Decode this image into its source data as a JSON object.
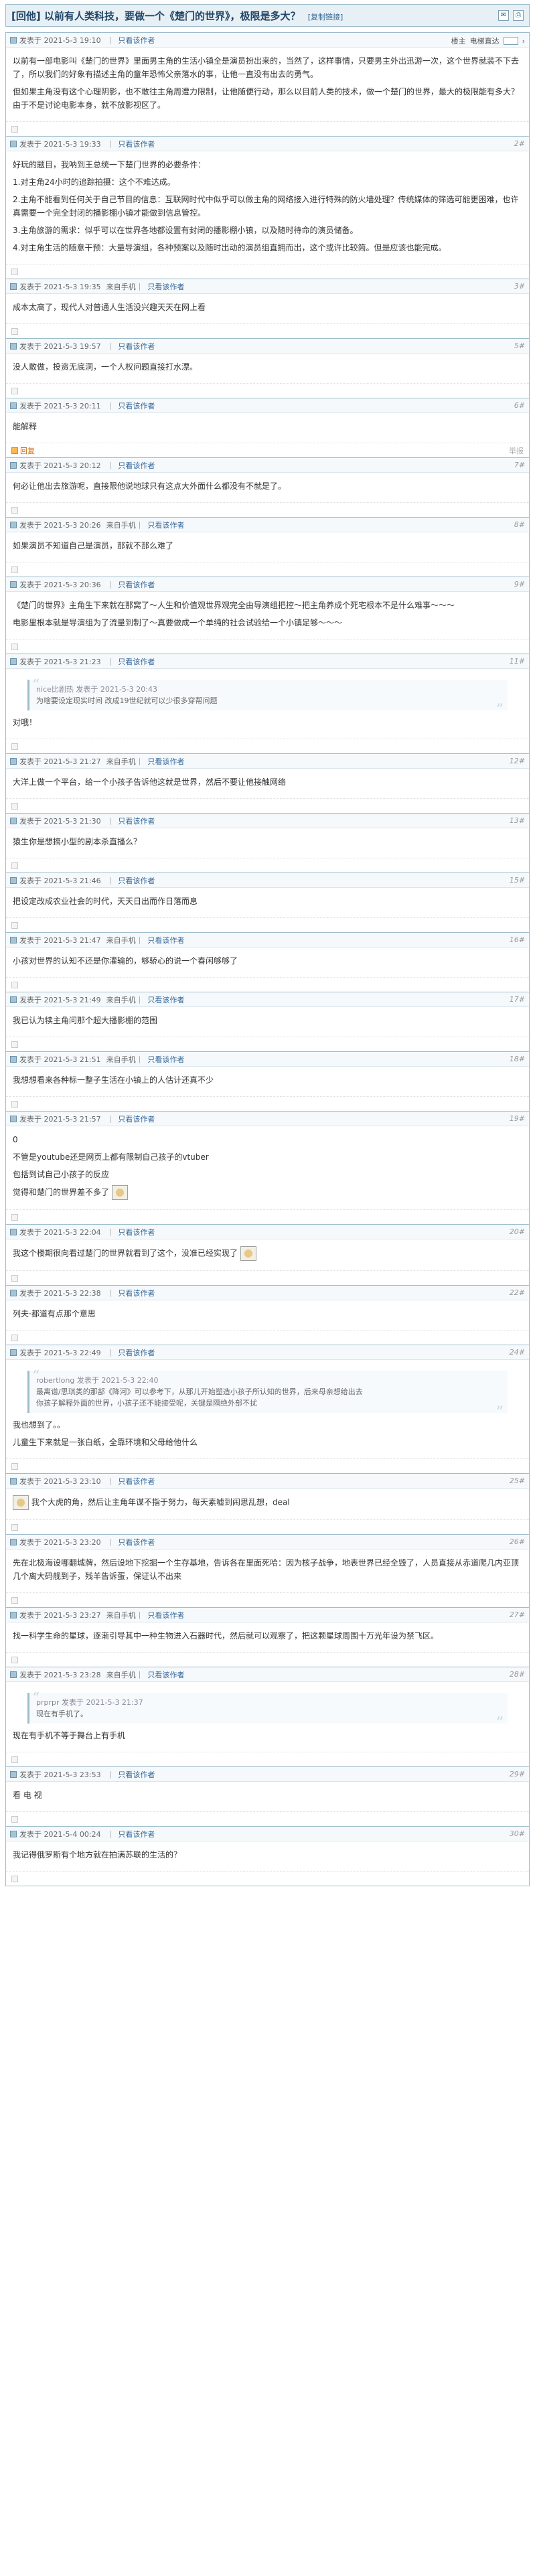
{
  "thread": {
    "reply_tag": "[回他]",
    "title": "以前有人类科技，要做一个《楚门的世界》，极限是多大？",
    "copy_link": "[复制链接]",
    "icons": [
      "mail-icon",
      "print-icon"
    ]
  },
  "labels": {
    "posted_at": "发表于",
    "only_author": "只看该作者",
    "from_mobile": "来自手机",
    "view_main": "楼主",
    "email_label": "电梯直达",
    "like": "回复",
    "report": "举报"
  },
  "posts": [
    {
      "time": "2021-5-3 19:10",
      "only_author": true,
      "mobile": false,
      "floor": "楼主",
      "tools": true,
      "paragraphs": [
        "以前有一部电影叫《楚门的世界》里面男主角的生活小镇全是演员扮出来的，当然了，这样事情，只要男主外出迅游一次，这个世界就装不下去了，所以我们的好象有描述主角的童年恐怖父亲落水的事，让他一直没有出去的勇气。",
        "但如果主角没有这个心理阴影，也不敢往主角周遭力限制，让他随便行动，那么以目前人类的技术，做一个楚门的世界，最大的极限能有多大？由于不是讨论电影本身，就不放影视区了。"
      ]
    },
    {
      "time": "2021-5-3 19:33",
      "only_author": true,
      "mobile": false,
      "floor": "2#",
      "paragraphs": [
        "好玩的题目，我呐到王总统一下楚门世界的必要条件：",
        "1.对主角24小时的追踪拍摄：这个不难达成。",
        "2.主角不能看到任何关于自己节目的信息：互联网时代中似乎可以做主角的网络接入进行特殊的防火墙处理？传统媒体的筛选可能更困难，也许真需要一个完全封闭的播影棚小镇才能做到信息管控。",
        "3.主角旅游的需求：似乎可以在世界各地都设置有封闭的播影棚小镇，以及随时待命的演员储备。",
        "4.对主角生活的随意干预：大量导演组，各种预案以及随时出动的演员组直拥而出，这个或许比较简。但是应该也能完成。"
      ]
    },
    {
      "time": "2021-5-3 19:35",
      "only_author": true,
      "mobile": true,
      "floor": "3#",
      "paragraphs": [
        "成本太高了，现代人对普通人生活没兴趣天天在网上看"
      ]
    },
    {
      "time": "2021-5-3 19:57",
      "only_author": true,
      "mobile": false,
      "floor": "5#",
      "paragraphs": [
        "没人敢做，投资无底洞，一个人权问题直接打水漂。"
      ]
    },
    {
      "time": "2021-5-3 20:11",
      "only_author": true,
      "mobile": false,
      "floor": "6#",
      "paragraphs": [
        "能解释"
      ],
      "hot": true
    },
    {
      "time": "2021-5-3 20:12",
      "only_author": true,
      "mobile": false,
      "floor": "7#",
      "paragraphs": [
        "何必让他出去旅游呢，直接限他说地球只有这点大外面什么都没有不就是了。"
      ]
    },
    {
      "time": "2021-5-3 20:26",
      "only_author": true,
      "mobile": true,
      "floor": "8#",
      "paragraphs": [
        "如果演员不知道自己是演员，那就不那么难了"
      ]
    },
    {
      "time": "2021-5-3 20:36",
      "only_author": true,
      "mobile": false,
      "floor": "9#",
      "paragraphs": [
        "《楚门的世界》主角生下来就在那窝了～人生和价值观世界观完全由导演组把控～把主角养成个死宅根本不是什么难事～～～",
        "电影里根本就是导演组为了流量到制了～真要做成一个单纯的社会试验给一个小镇足够～～～"
      ]
    },
    {
      "time": "2021-5-3 21:23",
      "only_author": true,
      "mobile": false,
      "floor": "11#",
      "quote": {
        "name": "nice比剧热 发表于 2021-5-3 20:43",
        "text": "为啥要设定现实时间  改成19世纪就可以少很多穿帮问题"
      },
      "paragraphs": [
        "对哦！"
      ]
    },
    {
      "time": "2021-5-3 21:27",
      "only_author": true,
      "mobile": true,
      "floor": "12#",
      "paragraphs": [
        "大洋上做一个平台，给一个小孩子告诉他这就是世界，然后不要让他接触网络"
      ]
    },
    {
      "time": "2021-5-3 21:30",
      "only_author": true,
      "mobile": false,
      "floor": "13#",
      "paragraphs": [
        "猿生你是想搞小型的剧本杀直播么？"
      ]
    },
    {
      "time": "2021-5-3 21:46",
      "only_author": true,
      "mobile": false,
      "floor": "15#",
      "paragraphs": [
        "把设定改成农业社会的时代，天天日出而作日落而息"
      ]
    },
    {
      "time": "2021-5-3 21:47",
      "only_author": true,
      "mobile": true,
      "floor": "16#",
      "paragraphs": [
        "小孩对世界的认知不还是你灌输的，够骄心的说一个春闲够够了"
      ]
    },
    {
      "time": "2021-5-3 21:49",
      "only_author": true,
      "mobile": true,
      "floor": "17#",
      "paragraphs": [
        "我已认为犊主角问那个超大播影棚的范围"
      ]
    },
    {
      "time": "2021-5-3 21:51",
      "only_author": true,
      "mobile": true,
      "floor": "18#",
      "paragraphs": [
        "我想想看来各种标一整子生活在小镇上的人估计还真不少"
      ]
    },
    {
      "time": "2021-5-3 21:57",
      "only_author": true,
      "mobile": false,
      "floor": "19#",
      "paragraphs": [
        "0",
        "不管是youtube还是网页上都有限制自己孩子的vtuber",
        "包括到试自己小孩子的反应",
        "觉得和楚门的世界差不多了"
      ],
      "emoji_after_last": true
    },
    {
      "time": "2021-5-3 22:04",
      "only_author": true,
      "mobile": false,
      "floor": "20#",
      "paragraphs": [
        "我这个楼期很向看过楚门的世界就看到了这个，没准已经实现了"
      ],
      "emoji_after_last": true
    },
    {
      "time": "2021-5-3 22:38",
      "only_author": true,
      "mobile": false,
      "floor": "22#",
      "paragraphs": [
        "列夫·都道有点那个意思"
      ]
    },
    {
      "time": "2021-5-3 22:49",
      "only_author": true,
      "mobile": false,
      "floor": "24#",
      "quote": {
        "name": "robertlong 发表于 2021-5-3 22:40",
        "text": "最离谱/思琪类的那部《降河》可以参考下，从那儿开始塑造小孩子所认知的世界，后来母亲想给出去\n你孩子解释外面的世界，小孩子还不能接受呢，关键是隔绝外部不扰"
      },
      "paragraphs": [
        "我也想到了。。",
        "儿童生下来就是一张白纸，全靠环境和父母给他什么"
      ]
    },
    {
      "time": "2021-5-3 23:10",
      "only_author": true,
      "mobile": false,
      "floor": "25#",
      "paragraphs": [
        "我个大虎的角，然后让主角年谋不指于努力，每天素嘘到闹思乱想，deal"
      ],
      "emoji_before_first": true
    },
    {
      "time": "2021-5-3 23:20",
      "only_author": true,
      "mobile": false,
      "floor": "26#",
      "paragraphs": [
        "先在北极海设哪翻城牌，然后设地下挖掘一个生存基地，告诉各在里面死哈：因为核子战争，地表世界已经全毁了，人员直接从赤道爬几内亚顶几个离大码舰到子，残羊告诉蛋，保证认不出来"
      ]
    },
    {
      "time": "2021-5-3 23:27",
      "only_author": true,
      "mobile": true,
      "floor": "27#",
      "paragraphs": [
        "找一科学生命的星球，逐渐引导其中一种生物进入石器时代，然后就可以观察了，把这颗星球周围十万光年设为禁飞区。"
      ]
    },
    {
      "time": "2021-5-3 23:28",
      "only_author": true,
      "mobile": true,
      "floor": "28#",
      "quote": {
        "name": "prprpr 发表于 2021-5-3 21:37",
        "text": "现在有手机了。"
      },
      "paragraphs": [
        "现在有手机不等于舞台上有手机"
      ]
    },
    {
      "time": "2021-5-3 23:53",
      "only_author": true,
      "mobile": false,
      "floor": "29#",
      "paragraphs": [
        "看  电  视"
      ]
    },
    {
      "time": "2021-5-4 00:24",
      "only_author": true,
      "mobile": false,
      "floor": "30#",
      "paragraphs": [
        "我记得俄罗斯有个地方就在拍满苏联的生活的？"
      ]
    }
  ]
}
